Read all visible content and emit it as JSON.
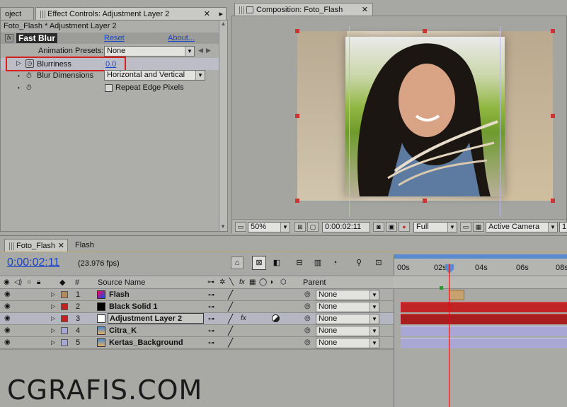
{
  "effect_panel": {
    "tab_project": "oject",
    "tab_effect_controls": "Effect Controls: Adjustment Layer 2",
    "breadcrumb": "Foto_Flash * Adjustment Layer 2",
    "effect_name": "Fast Blur",
    "reset_label": "Reset",
    "about_label": "About...",
    "animation_presets_label": "Animation Presets:",
    "animation_presets_value": "None",
    "blurriness_label": "Blurriness",
    "blurriness_value": "0.0",
    "blur_dimensions_label": "Blur Dimensions",
    "blur_dimensions_value": "Horizontal and Vertical",
    "repeat_edge_label": "Repeat Edge Pixels",
    "fx_icon": "fx-icon"
  },
  "comp_panel": {
    "tab_label": "Composition: Foto_Flash",
    "zoom": "50%",
    "timecode": "0:00:02:11",
    "resolution": "Full",
    "camera": "Active Camera",
    "extra": "1"
  },
  "timeline": {
    "tab_active": "Foto_Flash",
    "tab_other": "Flash",
    "timecode": "0:00:02:11",
    "fps": "(23.976 fps)",
    "col_hash": "#",
    "col_source": "Source Name",
    "col_parent": "Parent",
    "ruler": [
      "00s",
      "02s",
      "04s",
      "06s",
      "08s"
    ],
    "layers": [
      {
        "num": "1",
        "name": "Flash",
        "label_color": "#b38a5a",
        "parent": "None",
        "fx": ""
      },
      {
        "num": "2",
        "name": "Black Solid 1",
        "label_color": "#c42020",
        "parent": "None",
        "fx": ""
      },
      {
        "num": "3",
        "name": "Adjustment Layer 2",
        "label_color": "#c42020",
        "parent": "None",
        "fx": "fx"
      },
      {
        "num": "4",
        "name": "Citra_K",
        "label_color": "#a8a8d6",
        "parent": "None",
        "fx": ""
      },
      {
        "num": "5",
        "name": "Kertas_Background",
        "label_color": "#a8a8d6",
        "parent": "None",
        "fx": ""
      }
    ]
  },
  "watermark": "CGRAFIS.COM",
  "colors": {
    "red_bar": "#c02424",
    "purple_bar": "#a9a8d4",
    "playhead": "#d01010",
    "highlight_box": "#d62020"
  }
}
